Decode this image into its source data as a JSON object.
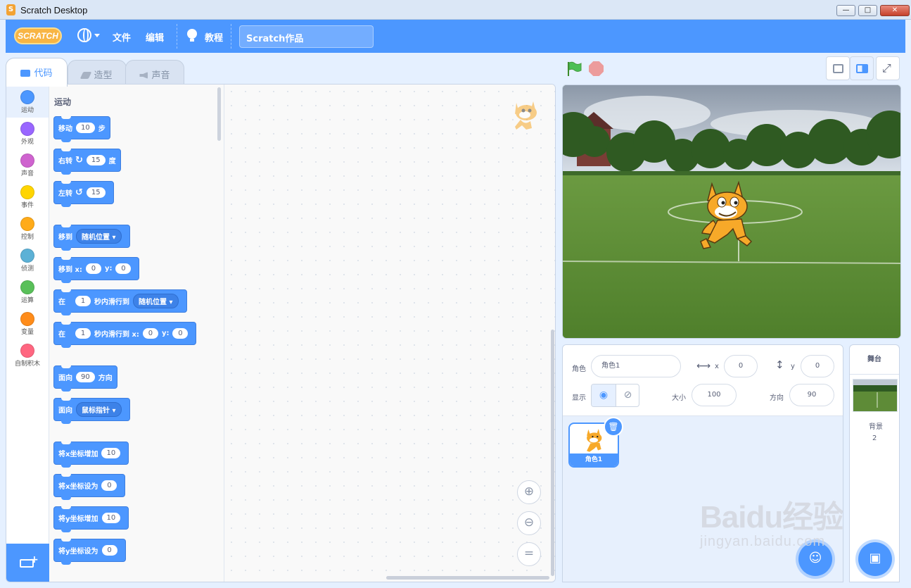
{
  "window": {
    "title": "Scratch Desktop",
    "min": "—",
    "max": "□",
    "close": "✕"
  },
  "menubar": {
    "logo": "SCRATCH",
    "file": "文件",
    "edit": "编辑",
    "tutorials": "教程",
    "project_title": "Scratch作品"
  },
  "tabs": {
    "code": "代码",
    "costumes": "造型",
    "sounds": "声音"
  },
  "categories": [
    "运动",
    "外观",
    "声音",
    "事件",
    "控制",
    "侦测",
    "运算",
    "变量",
    "自制积木"
  ],
  "category_colors": [
    "#4c97ff",
    "#9966ff",
    "#cf63cf",
    "#ffd500",
    "#ffab19",
    "#5cb1d6",
    "#59c059",
    "#ff8c1a",
    "#ff6680"
  ],
  "palette": {
    "heading": "运动",
    "move": {
      "label": "移动",
      "value": "10",
      "unit": "步"
    },
    "turn_right": {
      "label": "右转",
      "value": "15",
      "unit": "度"
    },
    "turn_left": {
      "label": "左转",
      "value": "15",
      "unit": "度"
    },
    "goto": {
      "label": "移到",
      "option": "随机位置"
    },
    "goto_xy": {
      "label": "移到 x:",
      "x": "0",
      "y_label": "y:",
      "y": "0"
    },
    "glide": {
      "pre": "在",
      "secs": "1",
      "mid": "秒内滑行到",
      "option": "随机位置"
    },
    "glide_xy": {
      "pre": "在",
      "secs": "1",
      "mid": "秒内滑行到 x:",
      "x": "0",
      "y_label": "y:",
      "y": "0"
    },
    "point": {
      "label": "面向",
      "value": "90",
      "unit": "方向"
    },
    "point_towards": {
      "label": "面向",
      "option": "鼠标指针"
    },
    "change_x": {
      "label": "将x坐标增加",
      "value": "10"
    },
    "set_x": {
      "label": "将x坐标设为",
      "value": "0"
    },
    "change_y": {
      "label": "将y坐标增加",
      "value": "10"
    },
    "set_y": {
      "label": "将y坐标设为",
      "value": "0"
    }
  },
  "sprite_info": {
    "sprite_label": "角色",
    "sprite_name": "角色1",
    "x_label": "x",
    "x": "0",
    "y_label": "y",
    "y": "0",
    "show_label": "显示",
    "size_label": "大小",
    "size": "100",
    "direction_label": "方向",
    "direction": "90"
  },
  "sprites": [
    {
      "name": "角色1"
    }
  ],
  "stage_panel": {
    "title": "舞台",
    "backdrops_label": "背景",
    "backdrops_count": "2"
  },
  "watermark": {
    "line1": "Baidu经验",
    "line2": "jingyan.baidu.com"
  }
}
